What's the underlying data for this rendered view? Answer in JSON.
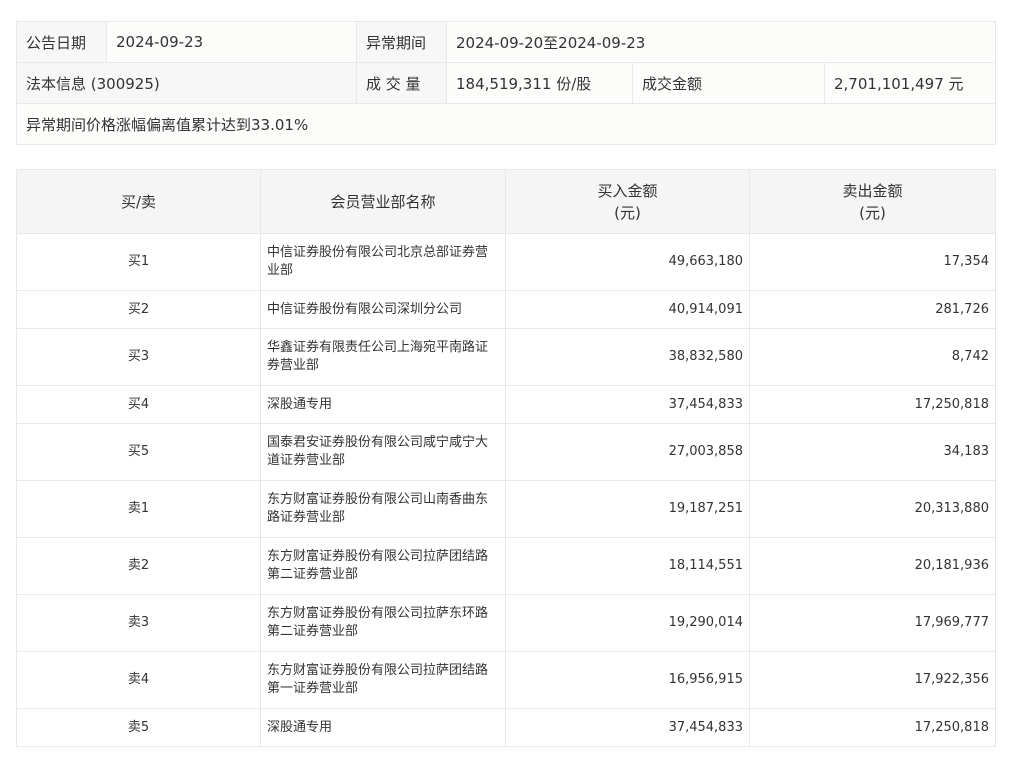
{
  "info": {
    "announce_date_label": "公告日期",
    "announce_date": "2024-09-23",
    "abnormal_period_label": "异常期间",
    "abnormal_period": "2024-09-20至2024-09-23",
    "stock_info": "法本信息 (300925)",
    "volume_label": "成 交 量",
    "volume": "184,519,311 份/股",
    "turnover_label": "成交金额",
    "turnover": "2,701,101,497 元",
    "reason": "异常期间价格涨幅偏离值累计达到33.01%"
  },
  "table": {
    "headers": {
      "side": "买/卖",
      "name": "会员营业部名称",
      "buy_amount": "买入金额",
      "buy_unit": "(元)",
      "sell_amount": "卖出金额",
      "sell_unit": "(元)"
    },
    "rows": [
      {
        "side": "买1",
        "name": "中信证券股份有限公司北京总部证券营业部",
        "buy": "49,663,180",
        "sell": "17,354"
      },
      {
        "side": "买2",
        "name": "中信证券股份有限公司深圳分公司",
        "buy": "40,914,091",
        "sell": "281,726"
      },
      {
        "side": "买3",
        "name": "华鑫证券有限责任公司上海宛平南路证券营业部",
        "buy": "38,832,580",
        "sell": "8,742"
      },
      {
        "side": "买4",
        "name": "深股通专用",
        "buy": "37,454,833",
        "sell": "17,250,818"
      },
      {
        "side": "买5",
        "name": "国泰君安证券股份有限公司咸宁咸宁大道证券营业部",
        "buy": "27,003,858",
        "sell": "34,183"
      },
      {
        "side": "卖1",
        "name": "东方财富证券股份有限公司山南香曲东路证券营业部",
        "buy": "19,187,251",
        "sell": "20,313,880"
      },
      {
        "side": "卖2",
        "name": "东方财富证券股份有限公司拉萨团结路第二证券营业部",
        "buy": "18,114,551",
        "sell": "20,181,936"
      },
      {
        "side": "卖3",
        "name": "东方财富证券股份有限公司拉萨东环路第二证券营业部",
        "buy": "19,290,014",
        "sell": "17,969,777"
      },
      {
        "side": "卖4",
        "name": "东方财富证券股份有限公司拉萨团结路第一证券营业部",
        "buy": "16,956,915",
        "sell": "17,922,356"
      },
      {
        "side": "卖5",
        "name": "深股通专用",
        "buy": "37,454,833",
        "sell": "17,250,818"
      }
    ]
  }
}
